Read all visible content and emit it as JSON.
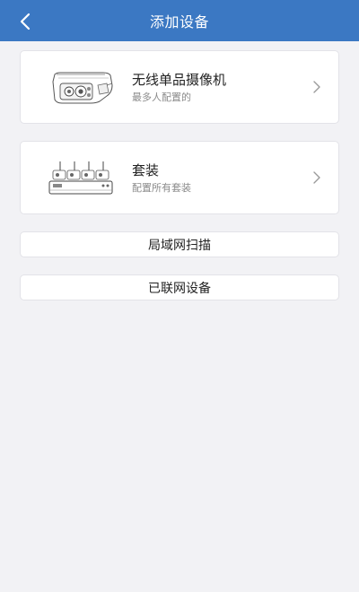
{
  "header": {
    "title": "添加设备",
    "background_color": "#3b78c3",
    "back_icon": "chevron-left-icon"
  },
  "devices": [
    {
      "title": "无线单品摄像机",
      "subtitle": "最多人配置的",
      "icon": "bullet-camera-icon"
    },
    {
      "title": "套装",
      "subtitle": "配置所有套装",
      "icon": "camera-kit-icon"
    }
  ],
  "actions": {
    "lan_scan": "局域网扫描",
    "connected_devices": "已联网设备"
  }
}
